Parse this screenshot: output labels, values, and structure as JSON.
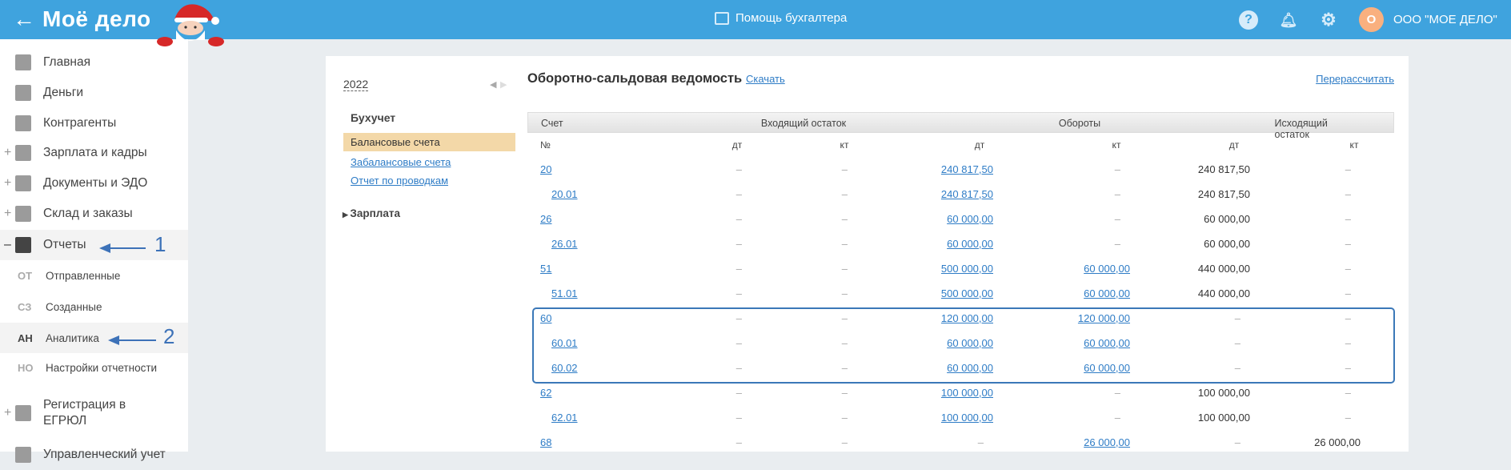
{
  "header": {
    "logo": "Моё дело",
    "center": "Помощь бухгалтера",
    "avatar_letter": "О",
    "org": "ООО \"МОЕ ДЕЛО\"",
    "colors": {
      "bar": "#3fa3de"
    }
  },
  "sidebar": {
    "items": [
      {
        "label": "Главная",
        "icon": "home-icon",
        "plus": ""
      },
      {
        "label": "Деньги",
        "icon": "money-icon",
        "plus": ""
      },
      {
        "label": "Контрагенты",
        "icon": "contractor-icon",
        "plus": ""
      },
      {
        "label": "Зарплата и кадры",
        "icon": "wallet-icon",
        "plus": "+"
      },
      {
        "label": "Документы и ЭДО",
        "icon": "folder-icon",
        "plus": "+"
      },
      {
        "label": "Склад и заказы",
        "icon": "cart-icon",
        "plus": "+"
      },
      {
        "label": "Отчеты",
        "icon": "report-icon",
        "plus": "–"
      }
    ],
    "sub": [
      {
        "abbr": "ОТ",
        "label": "Отправленные"
      },
      {
        "abbr": "СЗ",
        "label": "Созданные"
      },
      {
        "abbr": "АН",
        "label": "Аналитика"
      },
      {
        "abbr": "НО",
        "label": "Настройки отчетности"
      }
    ],
    "more": [
      {
        "label1": "Регистрация в",
        "label2": "ЕГРЮЛ",
        "plus": "+"
      },
      {
        "label": "Управленческий учет"
      }
    ]
  },
  "annotations": {
    "a1": "1",
    "a2": "2"
  },
  "leftpanel": {
    "year": "2022",
    "section": "Бухучет",
    "items": [
      "Балансовые счета",
      "Забалансовые счета",
      "Отчет по проводкам"
    ],
    "zarplata": "Зарплата"
  },
  "report": {
    "title": "Оборотно-сальдовая ведомость",
    "download": "Скачать",
    "recalc": "Перерассчитать",
    "groups": [
      "Счет",
      "Входящий остаток",
      "Обороты",
      "Исходящий остаток"
    ],
    "sub": [
      "№",
      "дт",
      "кт",
      "дт",
      "кт",
      "дт",
      "кт"
    ],
    "rows": [
      {
        "acc": "20",
        "sub": false,
        "v": [
          "–",
          "–",
          "240 817,50",
          "–",
          "240 817,50",
          "–"
        ]
      },
      {
        "acc": "20.01",
        "sub": true,
        "v": [
          "–",
          "–",
          "240 817,50",
          "–",
          "240 817,50",
          "–"
        ]
      },
      {
        "acc": "26",
        "sub": false,
        "v": [
          "–",
          "–",
          "60 000,00",
          "–",
          "60 000,00",
          "–"
        ]
      },
      {
        "acc": "26.01",
        "sub": true,
        "v": [
          "–",
          "–",
          "60 000,00",
          "–",
          "60 000,00",
          "–"
        ]
      },
      {
        "acc": "51",
        "sub": false,
        "v": [
          "–",
          "–",
          "500 000,00",
          "60 000,00",
          "440 000,00",
          "–"
        ]
      },
      {
        "acc": "51.01",
        "sub": true,
        "v": [
          "–",
          "–",
          "500 000,00",
          "60 000,00",
          "440 000,00",
          "–"
        ]
      },
      {
        "acc": "60",
        "sub": false,
        "v": [
          "–",
          "–",
          "120 000,00",
          "120 000,00",
          "–",
          "–"
        ]
      },
      {
        "acc": "60.01",
        "sub": true,
        "v": [
          "–",
          "–",
          "60 000,00",
          "60 000,00",
          "–",
          "–"
        ]
      },
      {
        "acc": "60.02",
        "sub": true,
        "v": [
          "–",
          "–",
          "60 000,00",
          "60 000,00",
          "–",
          "–"
        ]
      },
      {
        "acc": "62",
        "sub": false,
        "v": [
          "–",
          "–",
          "100 000,00",
          "–",
          "100 000,00",
          "–"
        ]
      },
      {
        "acc": "62.01",
        "sub": true,
        "v": [
          "–",
          "–",
          "100 000,00",
          "–",
          "100 000,00",
          "–"
        ]
      },
      {
        "acc": "68",
        "sub": false,
        "v": [
          "–",
          "–",
          "–",
          "26 000,00",
          "–",
          "26 000,00"
        ]
      }
    ]
  }
}
